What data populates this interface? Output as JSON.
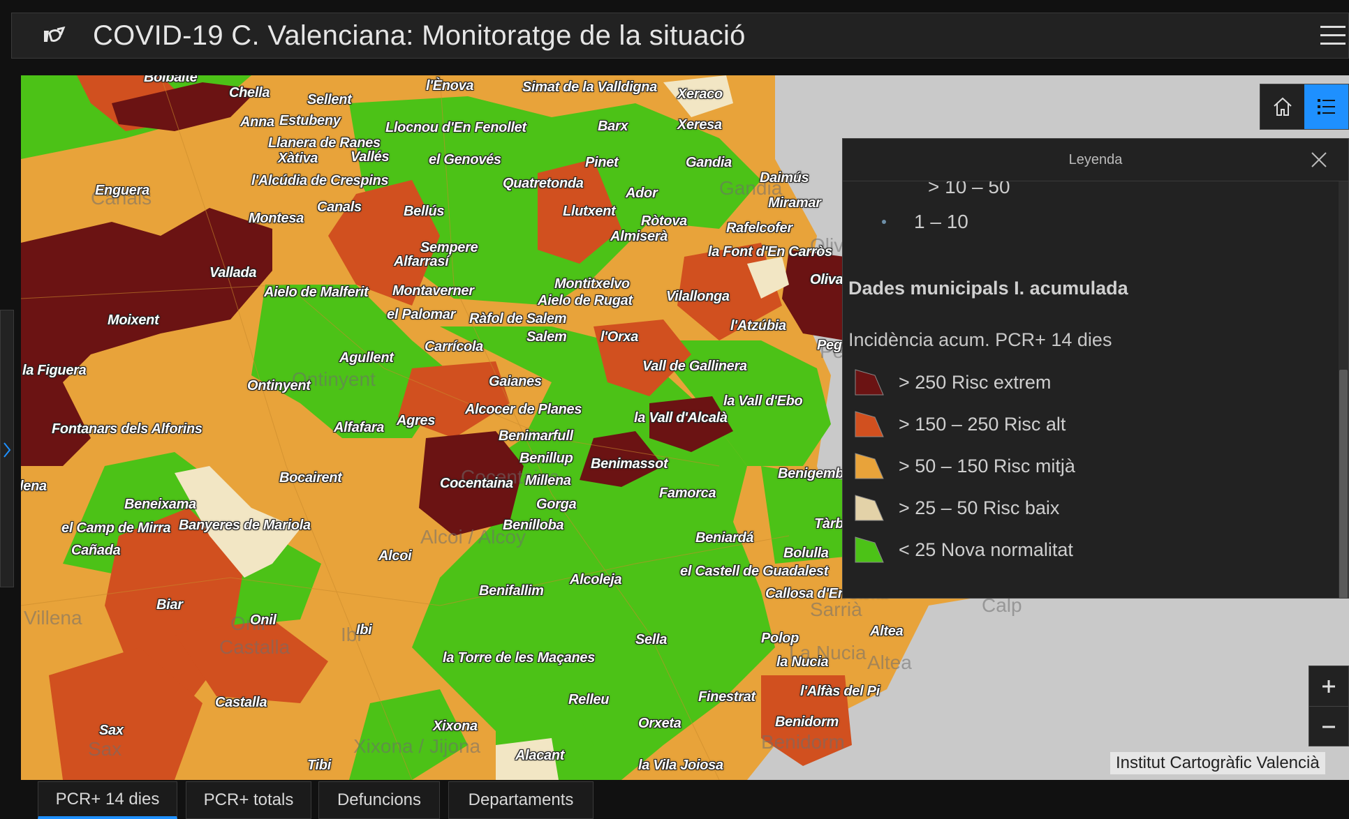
{
  "header": {
    "title": "COVID-19 C. Valenciana: Monitoratge de la situació"
  },
  "legend": {
    "title": "Leyenda",
    "cut_size_label": "> 10 – 50",
    "size_label": "1 – 10",
    "layer_title": "Dades municipals I. acumulada",
    "field_title": "Incidència acum. PCR+ 14 dies",
    "items": [
      {
        "label": "> 250 Risc extrem",
        "color": "#6b1313"
      },
      {
        "label": "> 150 – 250 Risc alt",
        "color": "#d1501f"
      },
      {
        "label": "> 50 – 150 Risc mitjà",
        "color": "#e8a33a"
      },
      {
        "label": "> 25 – 50 Risc baix",
        "color": "#e3d2a8"
      },
      {
        "label": "< 25 Nova normalitat",
        "color": "#4cc217"
      }
    ]
  },
  "map": {
    "attribution": "Institut Cartogràfic Valencià",
    "places": [
      "Bolbaite",
      "Chella",
      "Sellent",
      "l'Ènova",
      "Simat de la Valldigna",
      "Xeraco",
      "Anna",
      "Estubeny",
      "Llocnou d'En Fenollet",
      "Barx",
      "Xeresa",
      "Llanera de Ranes",
      "Xàtiva",
      "Vallés",
      "el Genovés",
      "Pinet",
      "Gandia",
      "Enguera",
      "l'Alcúdia de Crespins",
      "Quatretonda",
      "Daimús",
      "Canals",
      "Ador",
      "Miramar",
      "Montesa",
      "Bellús",
      "Llutxent",
      "Ròtova",
      "Rafelcofer",
      "Almiserà",
      "Sempere",
      "Alfarrasí",
      "la Font d'En Carròs",
      "Vallada",
      "Oliva",
      "Aielo de Malferit",
      "Montaverner",
      "Montitxelvo",
      "Aielo de Rugat",
      "Vilallonga",
      "Moixent",
      "el Palomar",
      "Ràfol de Salem",
      "Salem",
      "l'Orxa",
      "l'Atzúbia",
      "Agullent",
      "Carrícola",
      "la Figuera",
      "Vall de Gallinera",
      "Peg",
      "Ontinyent",
      "Gaianes",
      "la Vall d'Ebo",
      "Alcocer de Planes",
      "la Vall d'Alcalà",
      "Fontanars dels Alforins",
      "Alfafara",
      "Agres",
      "Benimarfull",
      "Benillup",
      "Benimassot",
      "Bocairent",
      "Millena",
      "Cocentaina",
      "Benigembla",
      "Beneixama",
      "Gorga",
      "Famorca",
      "lena",
      "el Camp de Mirra",
      "Banyeres de Mariola",
      "Benilloba",
      "Tàrbena",
      "Cañada",
      "Beniardá",
      "Bolulla",
      "Alcoi",
      "el Castell de Guadalest",
      "Alcoleja",
      "Benifallim",
      "Callosa d'En Sarrià",
      "Biar",
      "Onil",
      "Sella",
      "Ibi",
      "Polop",
      "Altea",
      "la Torre de les Maçanes",
      "la Nucia",
      "l'Alfàs del Pi",
      "Castalla",
      "Relleu",
      "Finestrat",
      "Sax",
      "Xixona",
      "Orxeta",
      "Benidorm",
      "Alacant",
      "Tibi",
      "la Vila Joiosa"
    ],
    "region_labels": [
      "Canals",
      "Ontinyent",
      "Gandia",
      "Oliva",
      "Pego",
      "Cocentaina",
      "Alcoi / Alcoy",
      "Villena",
      "Onil",
      "Castalla",
      "Sax",
      "Xixona / Jijona",
      "Ibi",
      "Sarrià",
      "La Nucia",
      "Altea",
      "Benidorm",
      "Calp"
    ]
  },
  "tabs": [
    "PCR+ 14 dies",
    "PCR+ totals",
    "Defuncions",
    "Departaments"
  ]
}
